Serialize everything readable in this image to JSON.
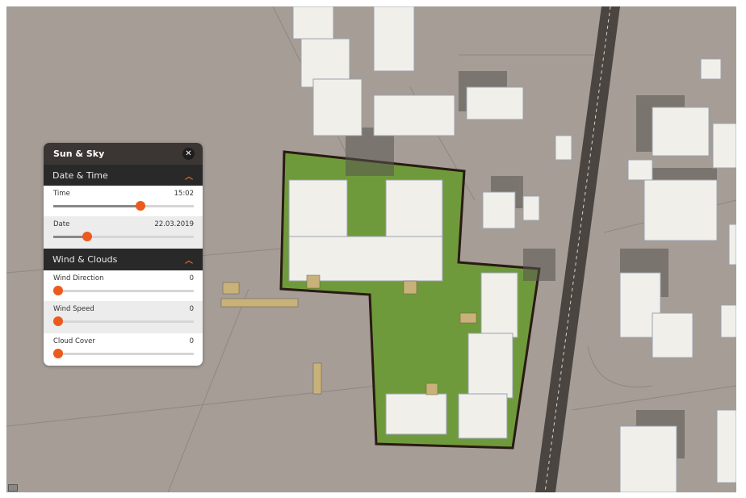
{
  "panel": {
    "title": "Sun & Sky",
    "close_icon": "close-icon",
    "sections": [
      {
        "title": "Date & Time",
        "icon": "chevron-up-icon",
        "sliders": [
          {
            "label": "Time",
            "value": "15:02",
            "percent": 62
          },
          {
            "label": "Date",
            "value": "22.03.2019",
            "percent": 24
          }
        ]
      },
      {
        "title": "Wind & Clouds",
        "icon": "chevron-up-icon",
        "sliders": [
          {
            "label": "Wind Direction",
            "value": "0",
            "percent": 0
          },
          {
            "label": "Wind Speed",
            "value": "0",
            "percent": 0
          },
          {
            "label": "Cloud Cover",
            "value": "0",
            "percent": 0
          }
        ]
      }
    ]
  },
  "colors": {
    "accent": "#ec5a1e",
    "plot": "#6f9a3c",
    "ground": "#a59d96",
    "road": "#4a4540"
  }
}
